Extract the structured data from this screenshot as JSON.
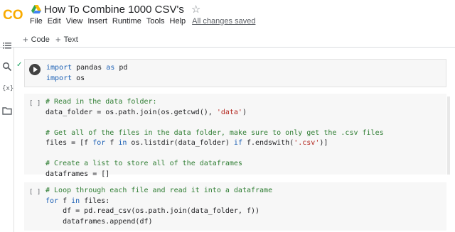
{
  "app": {
    "logo_text": "CO",
    "title": "How To Combine 1000 CSV's",
    "star_icon": "star-outline-icon",
    "menu": [
      "File",
      "Edit",
      "View",
      "Insert",
      "Runtime",
      "Tools",
      "Help"
    ],
    "save_status": "All changes saved"
  },
  "toolbar": {
    "code_label": "Code",
    "text_label": "Text"
  },
  "rail_icons": [
    "toc-icon",
    "search-icon",
    "variables-icon",
    "folder-icon"
  ],
  "rail_variables_glyph": "{x}",
  "cells": [
    {
      "status": "run",
      "lines": [
        [
          {
            "t": "import",
            "c": "kw"
          },
          {
            "t": " pandas ",
            "c": ""
          },
          {
            "t": "as",
            "c": "kw"
          },
          {
            "t": " pd",
            "c": ""
          }
        ],
        [
          {
            "t": "import",
            "c": "kw"
          },
          {
            "t": " os",
            "c": ""
          }
        ]
      ]
    },
    {
      "status": "[ ]",
      "lines": [
        [
          {
            "t": "# Read in the data folder:",
            "c": "cm"
          }
        ],
        [
          {
            "t": "data_folder = os.path.join(os.getcwd(), ",
            "c": ""
          },
          {
            "t": "'data'",
            "c": "st"
          },
          {
            "t": ")",
            "c": ""
          }
        ],
        [
          {
            "t": "",
            "c": ""
          }
        ],
        [
          {
            "t": "# Get all of the files in the data folder, make sure to only get the .csv files",
            "c": "cm"
          }
        ],
        [
          {
            "t": "files = [f ",
            "c": ""
          },
          {
            "t": "for",
            "c": "kw"
          },
          {
            "t": " f ",
            "c": ""
          },
          {
            "t": "in",
            "c": "kw"
          },
          {
            "t": " os.listdir(data_folder) ",
            "c": ""
          },
          {
            "t": "if",
            "c": "kw"
          },
          {
            "t": " f.endswith(",
            "c": ""
          },
          {
            "t": "'.csv'",
            "c": "st"
          },
          {
            "t": ")]",
            "c": ""
          }
        ],
        [
          {
            "t": "",
            "c": ""
          }
        ],
        [
          {
            "t": "# Create a list to store all of the dataframes",
            "c": "cm"
          }
        ],
        [
          {
            "t": "dataframes = []",
            "c": ""
          }
        ]
      ]
    },
    {
      "status": "[ ]",
      "lines": [
        [
          {
            "t": "# Loop through each file and read it into a dataframe",
            "c": "cm"
          }
        ],
        [
          {
            "t": "for",
            "c": "kw"
          },
          {
            "t": " f ",
            "c": ""
          },
          {
            "t": "in",
            "c": "kw"
          },
          {
            "t": " files:",
            "c": ""
          }
        ],
        [
          {
            "t": "    df = pd.read_csv(os.path.join(data_folder, f))",
            "c": ""
          }
        ],
        [
          {
            "t": "    dataframes.append(df)",
            "c": ""
          }
        ]
      ]
    }
  ],
  "colors": {
    "logo_orange": "#f9ab00",
    "keyword": "#1a5fb4",
    "comment": "#2e7d32",
    "string": "#b3261e",
    "success_check": "#0f9d58"
  }
}
